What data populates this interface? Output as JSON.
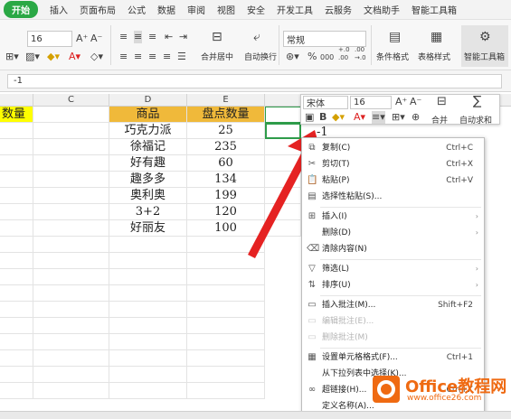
{
  "menu_tabs": [
    "开始",
    "插入",
    "页面布局",
    "公式",
    "数据",
    "审阅",
    "视图",
    "安全",
    "开发工具",
    "云服务",
    "文档助手",
    "智能工具箱"
  ],
  "ribbon": {
    "font_size": "16",
    "number_format": "常规",
    "merge_label": "合并居中",
    "wrap_label": "自动换行",
    "cond_format_label": "条件格式",
    "table_style_label": "表格样式",
    "smart_toolbox_label": "智能工具箱",
    "percent": "%",
    "thousands": "000",
    "dec_inc": "+.0 .00",
    "dec_dec": ".00 →.0"
  },
  "formula": {
    "value": "-1"
  },
  "columns": [
    "C",
    "D",
    "E"
  ],
  "sheet": {
    "left_header": "数量",
    "header_product": "商品",
    "header_count": "盘点数量",
    "rows": [
      {
        "name": "巧克力派",
        "count": "25"
      },
      {
        "name": "徐福记",
        "count": "235"
      },
      {
        "name": "好有趣",
        "count": "60"
      },
      {
        "name": "趣多多",
        "count": "134"
      },
      {
        "name": "奥利奥",
        "count": "199"
      },
      {
        "name": "3+2",
        "count": "120"
      },
      {
        "name": "好丽友",
        "count": "100"
      }
    ],
    "active_cell_value": "-1"
  },
  "mini_toolbar": {
    "font": "宋体",
    "size": "16",
    "merge_label": "合并",
    "autosum_label": "自动求和"
  },
  "context_menu": [
    {
      "label": "复制(C)",
      "shortcut": "Ctrl+C",
      "icon": "copy-icon",
      "disabled": false
    },
    {
      "label": "剪切(T)",
      "shortcut": "Ctrl+X",
      "icon": "cut-icon",
      "disabled": false
    },
    {
      "label": "粘贴(P)",
      "shortcut": "Ctrl+V",
      "icon": "paste-icon",
      "disabled": false
    },
    {
      "label": "选择性粘贴(S)...",
      "shortcut": "",
      "icon": "paste-special-icon",
      "disabled": false
    },
    {
      "label": "插入(I)",
      "shortcut": "",
      "icon": "insert-icon",
      "disabled": false,
      "submenu": true
    },
    {
      "label": "删除(D)",
      "shortcut": "",
      "icon": "",
      "disabled": false,
      "submenu": true
    },
    {
      "label": "清除内容(N)",
      "shortcut": "",
      "icon": "clear-icon",
      "disabled": false
    },
    {
      "label": "筛选(L)",
      "shortcut": "",
      "icon": "filter-icon",
      "disabled": false,
      "submenu": true
    },
    {
      "label": "排序(U)",
      "shortcut": "",
      "icon": "sort-icon",
      "disabled": false,
      "submenu": true
    },
    {
      "label": "插入批注(M)...",
      "shortcut": "Shift+F2",
      "icon": "comment-icon",
      "disabled": false
    },
    {
      "label": "编辑批注(E)...",
      "shortcut": "",
      "icon": "edit-comment-icon",
      "disabled": true
    },
    {
      "label": "删除批注(M)",
      "shortcut": "",
      "icon": "delete-comment-icon",
      "disabled": true
    },
    {
      "label": "设置单元格格式(F)...",
      "shortcut": "Ctrl+1",
      "icon": "format-cells-icon",
      "disabled": false
    },
    {
      "label": "从下拉列表中选择(K)...",
      "shortcut": "",
      "icon": "",
      "disabled": false
    },
    {
      "label": "超链接(H)...",
      "shortcut": "Ctrl+K",
      "icon": "link-icon",
      "disabled": false
    },
    {
      "label": "定义名称(A)...",
      "shortcut": "",
      "icon": "",
      "disabled": false
    }
  ],
  "watermark": {
    "title": "Office教程网",
    "url": "www.office26.com"
  },
  "colors": {
    "accent_green": "#2aa845",
    "header_yellow": "#ffff00",
    "header_orange": "#f0b93a",
    "arrow_red": "#e52222",
    "watermark_orange": "#ef6a12"
  }
}
